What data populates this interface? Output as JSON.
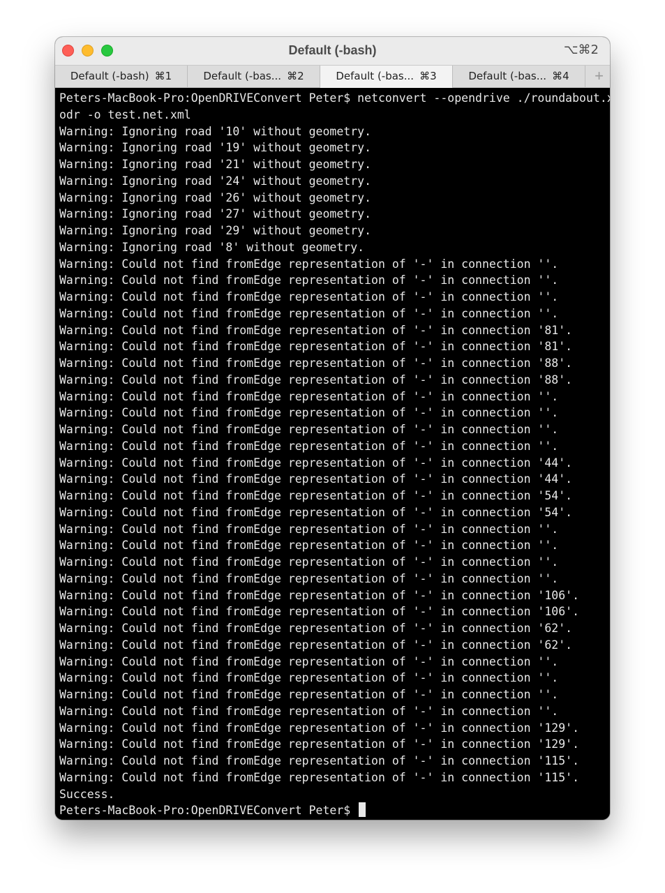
{
  "window": {
    "title": "Default (-bash)",
    "shortcut": "⌥⌘2"
  },
  "tabs": [
    {
      "label": "Default (-bash)",
      "shortcut": "⌘1",
      "active": false
    },
    {
      "label": "Default (-bas...",
      "shortcut": "⌘2",
      "active": false
    },
    {
      "label": "Default (-bas...",
      "shortcut": "⌘3",
      "active": true
    },
    {
      "label": "Default (-bas...",
      "shortcut": "⌘4",
      "active": false
    }
  ],
  "tab_add_label": "+",
  "terminal": {
    "lines": [
      "Peters-MacBook-Pro:OpenDRIVEConvert Peter$ netconvert --opendrive ./roundabout.x",
      "odr -o test.net.xml",
      "Warning: Ignoring road '10' without geometry.",
      "Warning: Ignoring road '19' without geometry.",
      "Warning: Ignoring road '21' without geometry.",
      "Warning: Ignoring road '24' without geometry.",
      "Warning: Ignoring road '26' without geometry.",
      "Warning: Ignoring road '27' without geometry.",
      "Warning: Ignoring road '29' without geometry.",
      "Warning: Ignoring road '8' without geometry.",
      "Warning: Could not find fromEdge representation of '-' in connection ''.",
      "Warning: Could not find fromEdge representation of '-' in connection ''.",
      "Warning: Could not find fromEdge representation of '-' in connection ''.",
      "Warning: Could not find fromEdge representation of '-' in connection ''.",
      "Warning: Could not find fromEdge representation of '-' in connection '81'.",
      "Warning: Could not find fromEdge representation of '-' in connection '81'.",
      "Warning: Could not find fromEdge representation of '-' in connection '88'.",
      "Warning: Could not find fromEdge representation of '-' in connection '88'.",
      "Warning: Could not find fromEdge representation of '-' in connection ''.",
      "Warning: Could not find fromEdge representation of '-' in connection ''.",
      "Warning: Could not find fromEdge representation of '-' in connection ''.",
      "Warning: Could not find fromEdge representation of '-' in connection ''.",
      "Warning: Could not find fromEdge representation of '-' in connection '44'.",
      "Warning: Could not find fromEdge representation of '-' in connection '44'.",
      "Warning: Could not find fromEdge representation of '-' in connection '54'.",
      "Warning: Could not find fromEdge representation of '-' in connection '54'.",
      "Warning: Could not find fromEdge representation of '-' in connection ''.",
      "Warning: Could not find fromEdge representation of '-' in connection ''.",
      "Warning: Could not find fromEdge representation of '-' in connection ''.",
      "Warning: Could not find fromEdge representation of '-' in connection ''.",
      "Warning: Could not find fromEdge representation of '-' in connection '106'.",
      "Warning: Could not find fromEdge representation of '-' in connection '106'.",
      "Warning: Could not find fromEdge representation of '-' in connection '62'.",
      "Warning: Could not find fromEdge representation of '-' in connection '62'.",
      "Warning: Could not find fromEdge representation of '-' in connection ''.",
      "Warning: Could not find fromEdge representation of '-' in connection ''.",
      "Warning: Could not find fromEdge representation of '-' in connection ''.",
      "Warning: Could not find fromEdge representation of '-' in connection ''.",
      "Warning: Could not find fromEdge representation of '-' in connection '129'.",
      "Warning: Could not find fromEdge representation of '-' in connection '129'.",
      "Warning: Could not find fromEdge representation of '-' in connection '115'.",
      "Warning: Could not find fromEdge representation of '-' in connection '115'.",
      "Success."
    ],
    "prompt": "Peters-MacBook-Pro:OpenDRIVEConvert Peter$ "
  },
  "colors": {
    "close": "#fe5f57",
    "minimize": "#febc2e",
    "maximize": "#28c840",
    "terminal_bg": "#000000",
    "terminal_fg": "#e8e8e8"
  }
}
